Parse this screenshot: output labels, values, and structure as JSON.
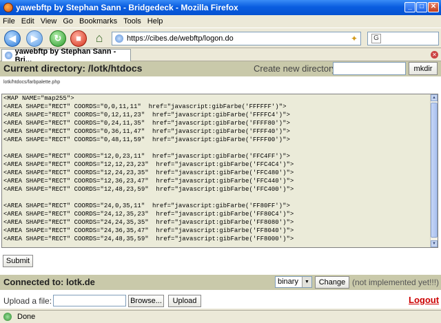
{
  "window": {
    "title": "yawebftp by Stephan Sann - Bridgedeck - Mozilla Firefox",
    "min_glyph": "_",
    "max_glyph": "□",
    "close_glyph": "✕"
  },
  "menu": [
    "File",
    "Edit",
    "View",
    "Go",
    "Bookmarks",
    "Tools",
    "Help"
  ],
  "nav": {
    "url": "https://cibes.de/webftp/logon.do",
    "search_glyph": "G"
  },
  "tab": {
    "label": "yawebftp by Stephan Sann - Bri..."
  },
  "dirbar": {
    "title": "Current directory: /lotk/htdocs",
    "new_dir_label": "Create new directory:",
    "new_dir_value": "",
    "mkdir_label": "mkdir"
  },
  "file_path": "lotk/htdocs/farbpalette.php",
  "editor_lines": [
    "<MAP NAME=\"map255\">",
    "<AREA SHAPE=\"RECT\" COORDS=\"0,0,11,11\"  href=\"javascript:gibFarbe('FFFFFF')\">",
    "<AREA SHAPE=\"RECT\" COORDS=\"0,12,11,23\"  href=\"javascript:gibFarbe('FFFFC4')\">",
    "<AREA SHAPE=\"RECT\" COORDS=\"0,24,11,35\"  href=\"javascript:gibFarbe('FFFF80')\">",
    "<AREA SHAPE=\"RECT\" COORDS=\"0,36,11,47\"  href=\"javascript:gibFarbe('FFFF40')\">",
    "<AREA SHAPE=\"RECT\" COORDS=\"0,48,11,59\"  href=\"javascript:gibFarbe('FFFF00')\">",
    "",
    "<AREA SHAPE=\"RECT\" COORDS=\"12,0,23,11\"  href=\"javascript:gibFarbe('FFC4FF')\">",
    "<AREA SHAPE=\"RECT\" COORDS=\"12,12,23,23\"  href=\"javascript:gibFarbe('FFC4C4')\">",
    "<AREA SHAPE=\"RECT\" COORDS=\"12,24,23,35\"  href=\"javascript:gibFarbe('FFC480')\">",
    "<AREA SHAPE=\"RECT\" COORDS=\"12,36,23,47\"  href=\"javascript:gibFarbe('FFC440')\">",
    "<AREA SHAPE=\"RECT\" COORDS=\"12,48,23,59\"  href=\"javascript:gibFarbe('FFC400')\">",
    "",
    "<AREA SHAPE=\"RECT\" COORDS=\"24,0,35,11\"  href=\"javascript:gibFarbe('FF80FF')\">",
    "<AREA SHAPE=\"RECT\" COORDS=\"24,12,35,23\"  href=\"javascript:gibFarbe('FF80C4')\">",
    "<AREA SHAPE=\"RECT\" COORDS=\"24,24,35,35\"  href=\"javascript:gibFarbe('FF8080')\">",
    "<AREA SHAPE=\"RECT\" COORDS=\"24,36,35,47\"  href=\"javascript:gibFarbe('FF8040')\">",
    "<AREA SHAPE=\"RECT\" COORDS=\"24,48,35,59\"  href=\"javascript:gibFarbe('FF8000')\">"
  ],
  "submit_label": "Submit",
  "connbar": {
    "title": "Connected to: lotk.de",
    "mode_value": "binary",
    "change_label": "Change",
    "note": "(not implemented yet!!!)"
  },
  "upload": {
    "label": "Upload a file:",
    "browse_label": "Browse...",
    "upload_label": "Upload",
    "logout_label": "Logout"
  },
  "status": {
    "text": "Done"
  },
  "colors": {
    "titlebar": "#0a5ee0",
    "section_bar": "#c9c9aa",
    "editor_bg": "#ebebd9",
    "logout": "#cc0000"
  }
}
